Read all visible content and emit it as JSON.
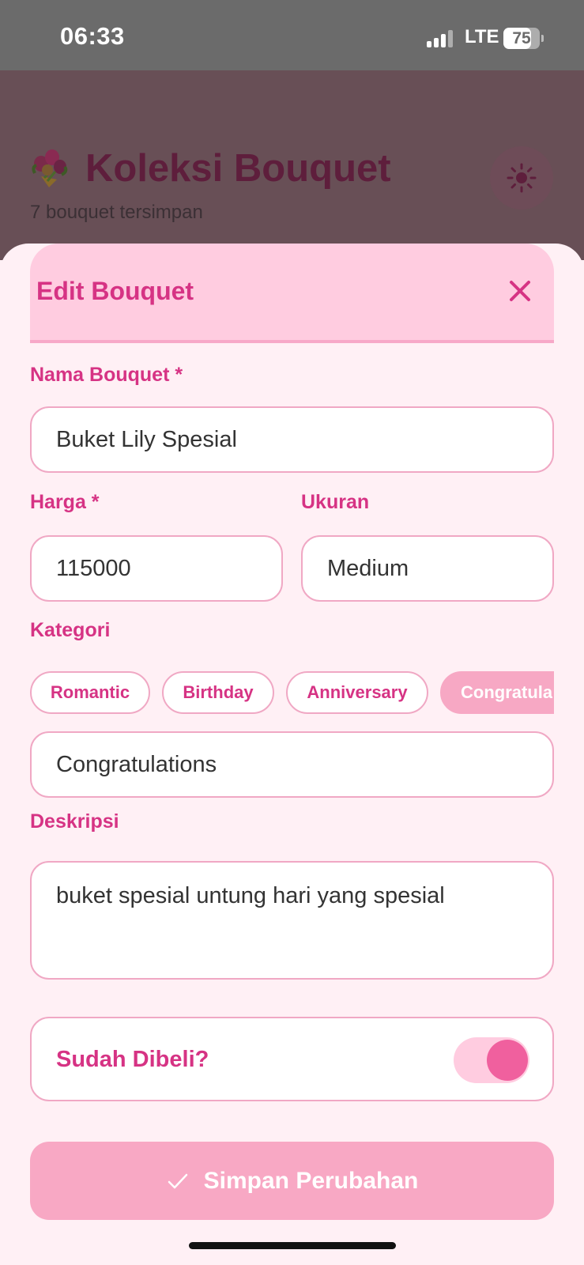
{
  "status_bar": {
    "time": "06:33",
    "network": "LTE",
    "battery": "75"
  },
  "background": {
    "title": "Koleksi Bouquet",
    "subtitle": "7 bouquet tersimpan"
  },
  "modal": {
    "title": "Edit Bouquet",
    "fields": {
      "name": {
        "label": "Nama Bouquet *",
        "value": "Buket Lily Spesial"
      },
      "price": {
        "label": "Harga *",
        "value": "115000"
      },
      "size": {
        "label": "Ukuran",
        "value": "Medium"
      },
      "category": {
        "label": "Kategori",
        "chips": [
          "Romantic",
          "Birthday",
          "Anniversary",
          "Congratulations"
        ],
        "value": "Congratulations"
      },
      "description": {
        "label": "Deskripsi",
        "value": "buket spesial untung hari yang spesial"
      }
    },
    "purchased": {
      "label": "Sudah Dibeli?",
      "on": true
    },
    "save_label": "Simpan Perubahan"
  },
  "colors": {
    "accent": "#d63384",
    "border": "#f0a8c4",
    "header_bg": "#ffcce0",
    "button": "#f8a8c4"
  }
}
